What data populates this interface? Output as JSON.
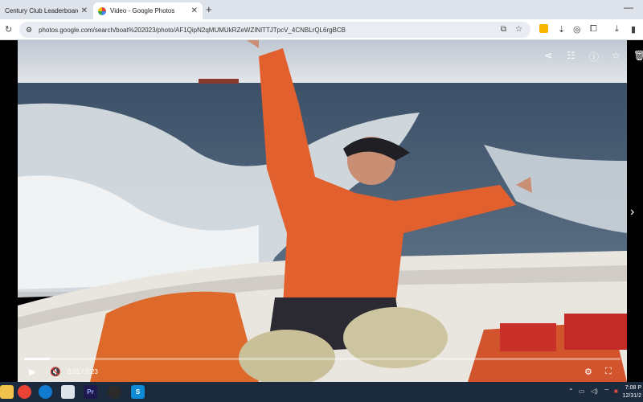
{
  "browser": {
    "tabs": [
      {
        "title": "Century Club Leaderboard | Spl",
        "active": false
      },
      {
        "title": "Video - Google Photos",
        "active": true
      }
    ],
    "url": "photos.google.com/search/boat%202023/photo/AF1QipN2qMUMUkRZeWZINlTTJTpcV_4CNBLrQL6rgBCB"
  },
  "player": {
    "current_time": "0:01",
    "duration": "0:23",
    "progress": 0.043
  },
  "taskbar": {
    "clock_time": "7:08 P",
    "clock_date": "12/31/2"
  }
}
